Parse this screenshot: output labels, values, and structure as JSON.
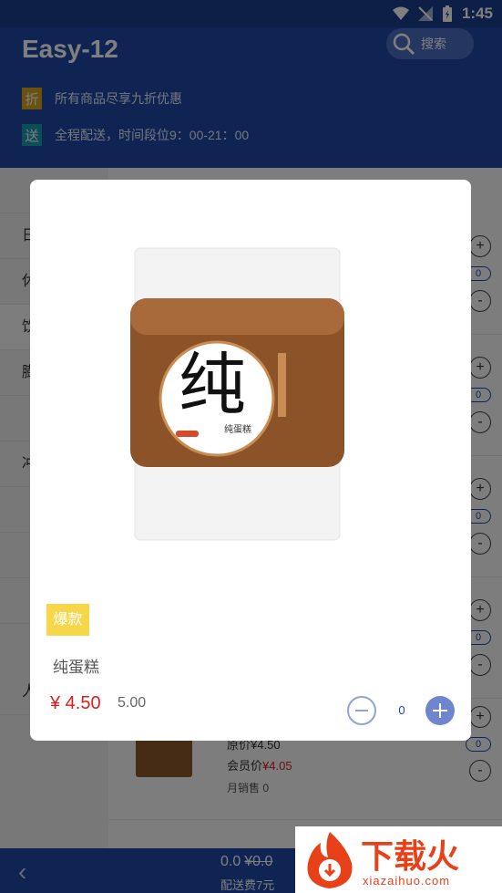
{
  "status_bar": {
    "time": "1:45"
  },
  "header": {
    "title": "Easy-12",
    "search_label": "搜索",
    "promos": [
      {
        "tag": "折",
        "tag_color": "#d6a21c",
        "text": "所有商品尽享九折优惠"
      },
      {
        "tag": "送",
        "tag_color": "#1a9bb0",
        "text": "全程配送，时间段位9：00-21：00"
      }
    ]
  },
  "categories": [
    "日",
    "休",
    "饮",
    "膨",
    "",
    "冲",
    "",
    "",
    "",
    "人"
  ],
  "list_item": {
    "orig_label": "原价",
    "orig_price": "¥4.50",
    "member_label": "会员价",
    "member_price": "¥4.05",
    "monthly_sales": "月销售 0",
    "count": "0"
  },
  "list_counts": [
    "0",
    "0",
    "0",
    "0"
  ],
  "modal": {
    "badge": "爆款",
    "product_name": "纯蛋糕",
    "price": "¥ 4.50",
    "original_price": "5.00",
    "quantity": "0",
    "image_label": "纯",
    "image_sub": "纯蛋糕"
  },
  "bottom_bar": {
    "total": "0.0",
    "total_original": "¥0.0",
    "delivery_fee": "配送费7元"
  },
  "watermark": {
    "title": "下载火",
    "url": "xiazaihuo.com"
  },
  "colors": {
    "primary": "#1f48a6",
    "price_red": "#e01b1b",
    "badge_yellow": "#f7d64a"
  }
}
